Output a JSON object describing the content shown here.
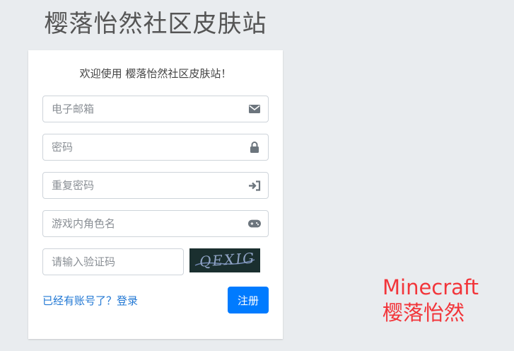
{
  "site_title": "樱落怡然社区皮肤站",
  "form": {
    "welcome": "欢迎使用 樱落怡然社区皮肤站！",
    "email_placeholder": "电子邮箱",
    "password_placeholder": "密码",
    "confirm_password_placeholder": "重复密码",
    "player_name_placeholder": "游戏内角色名",
    "captcha_placeholder": "请输入验证码",
    "captcha_text": "QEXIG",
    "login_link": "已经有账号了？登录",
    "register_button": "注册",
    "icons": {
      "email": "envelope-icon",
      "password": "lock-icon",
      "confirm_password": "sign-in-icon",
      "player_name": "gamepad-icon"
    }
  },
  "brand": {
    "line1": "Minecraft",
    "line2": "樱落怡然"
  },
  "colors": {
    "background": "#e9ecef",
    "primary": "#007bff",
    "link": "#2278d4",
    "brand": "#f2353a"
  }
}
